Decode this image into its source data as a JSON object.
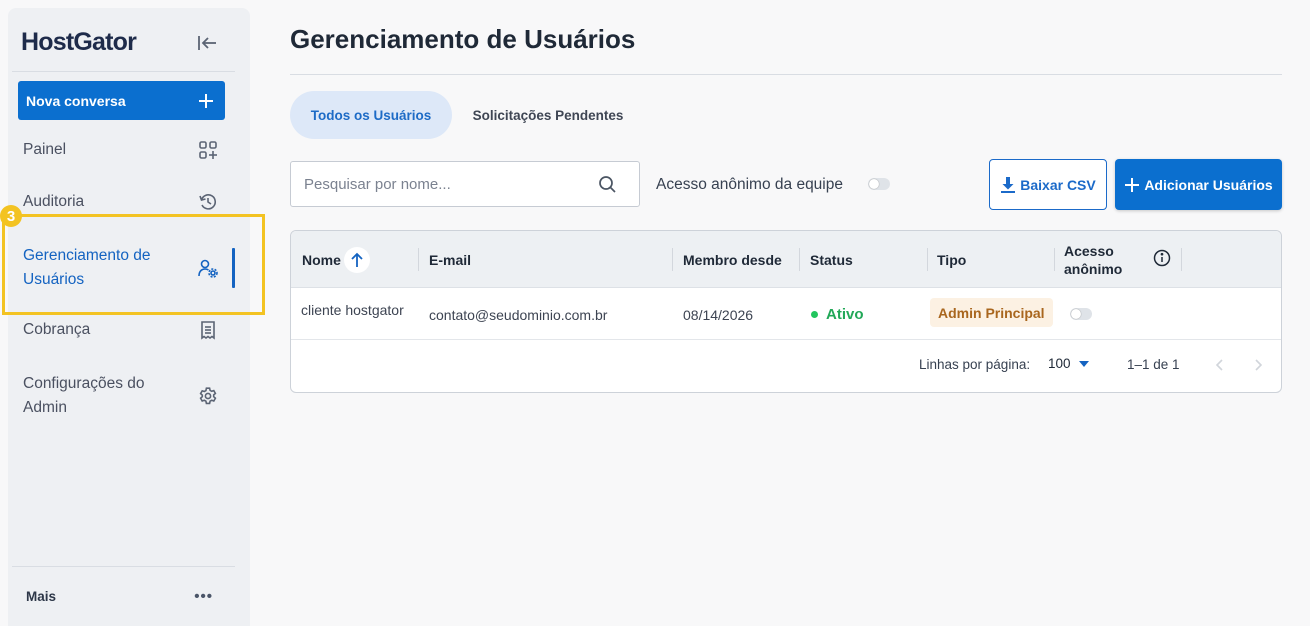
{
  "sidebar": {
    "logo": "HostGator",
    "new_chat_label": "Nova conversa",
    "items": [
      {
        "label": "Painel",
        "icon": "grid-plus-icon"
      },
      {
        "label": "Auditoria",
        "icon": "history-icon"
      },
      {
        "label": "Gerenciamento de Usuários",
        "icon": "users-gear-icon",
        "active": true
      },
      {
        "label": "Cobrança",
        "icon": "receipt-icon"
      },
      {
        "label": "Configurações do Admin",
        "icon": "gear-icon"
      }
    ],
    "more_label": "Mais",
    "more_dots": "•••",
    "step_badge": "3"
  },
  "header": {
    "title": "Gerenciamento de Usuários"
  },
  "tabs": [
    {
      "label": "Todos os Usuários",
      "active": true
    },
    {
      "label": "Solicitações Pendentes",
      "active": false
    }
  ],
  "toolbar": {
    "search_placeholder": "Pesquisar por nome...",
    "anon_label": "Acesso anônimo da equipe",
    "anon_enabled": false,
    "csv_label": "Baixar CSV",
    "add_label": "Adicionar Usuários"
  },
  "table": {
    "columns": [
      "Nome",
      "E-mail",
      "Membro desde",
      "Status",
      "Tipo",
      "Acesso anônimo"
    ],
    "rows": [
      {
        "name": "cliente hostgator",
        "email": "contato@seudominio.com.br",
        "member_since": "08/14/2026",
        "status": "Ativo",
        "type": "Admin Principal",
        "anon": false
      }
    ],
    "rows_per_page_label": "Linhas por página:",
    "rows_per_page": "100",
    "range": "1–1 de 1"
  },
  "colors": {
    "primary": "#0b6fcf",
    "active_status": "#22a858",
    "highlight": "#f3c322"
  }
}
